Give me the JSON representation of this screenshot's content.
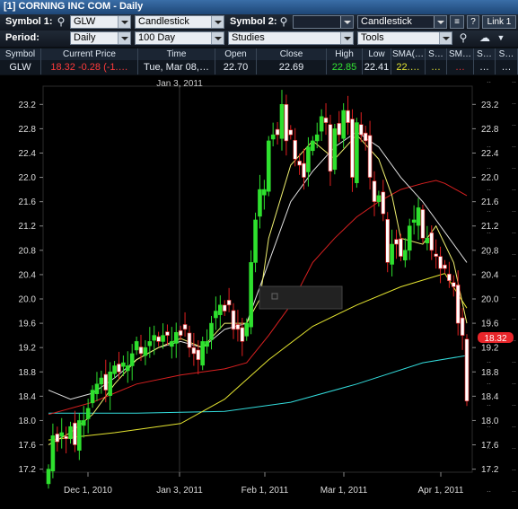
{
  "window": {
    "title": "[1] CORNING INC COM - Daily"
  },
  "toolbar": {
    "symbol1_label": "Symbol 1:",
    "symbol1_value": "GLW",
    "chart_type1": "Candlestick",
    "symbol2_label": "Symbol 2:",
    "symbol2_value": "",
    "chart_type2": "Candlestick",
    "help": "?",
    "link": "Link 1",
    "period_label": "Period:",
    "period": "Daily",
    "range": "100 Day",
    "studies": "Studies",
    "tools": "Tools"
  },
  "quote": {
    "headers": [
      "Symbol",
      "Current Price",
      "Time",
      "Open",
      "Close",
      "High",
      "Low",
      "SMA(…",
      "S…",
      "SM…",
      "S…",
      "S…"
    ],
    "symbol": "GLW",
    "price": "18.32",
    "change": "-0.28 (-1.…",
    "time": "Tue, Mar 08,…",
    "open": "22.70",
    "close": "22.69",
    "high": "22.85",
    "low": "22.41",
    "sma": "22.…",
    "s1": "…",
    "s2": "…",
    "s3": "…",
    "s4": "…",
    "colors": {
      "down": "#ff3b3b",
      "up": "#33e633",
      "sma": "#e6e633"
    }
  },
  "chart_data": {
    "type": "candlestick",
    "y_ticks": [
      17.2,
      17.6,
      18.0,
      18.4,
      18.8,
      19.2,
      19.6,
      20.0,
      20.4,
      20.8,
      21.2,
      21.6,
      22.0,
      22.4,
      22.8,
      23.2
    ],
    "ylim": [
      17.15,
      23.5
    ],
    "x_labels": [
      "Dec 1, 2010",
      "Jan 3, 2011",
      "Feb 1, 2011",
      "Mar 1, 2011",
      "Apr 1, 2011"
    ],
    "top_date_label": "Jan 3, 2011",
    "last_price_tag": "18.32",
    "up_color": "#2ee02e",
    "down_color": "#e02020",
    "closes": [
      17.2,
      17.75,
      17.65,
      17.8,
      17.7,
      17.9,
      17.6,
      18.0,
      18.0,
      18.2,
      18.5,
      18.6,
      18.7,
      18.5,
      18.8,
      18.9,
      18.8,
      18.95,
      18.9,
      19.1,
      19.3,
      19.1,
      19.2,
      19.3,
      19.4,
      19.3,
      19.4,
      19.4,
      19.3,
      19.45,
      19.4,
      19.5,
      19.2,
      19.1,
      19.0,
      19.3,
      19.3,
      19.6,
      19.8,
      19.9,
      19.8,
      19.9,
      19.5,
      19.5,
      19.3,
      19.6,
      20.6,
      21.3,
      21.8,
      21.8,
      22.6,
      22.7,
      22.7,
      23.2,
      22.6,
      22.7,
      22.3,
      22.2,
      22.0,
      22.5,
      22.6,
      22.7,
      23.0,
      22.9,
      22.1,
      22.8,
      22.7,
      23.1,
      22.9,
      22.0,
      22.9,
      22.7,
      22.6,
      22.0,
      21.6,
      21.7,
      21.4,
      20.6,
      20.9,
      20.9,
      20.7,
      20.8,
      21.2,
      21.3,
      21.5,
      21.0,
      21.0,
      20.8,
      20.7,
      20.5,
      20.5,
      20.3,
      20.2,
      19.6,
      19.4,
      18.32
    ],
    "series": [
      {
        "name": "SMA 100",
        "color": "#33dddd",
        "points": [
          [
            0,
            18.12
          ],
          [
            20,
            18.12
          ],
          [
            40,
            18.15
          ],
          [
            55,
            18.3
          ],
          [
            70,
            18.6
          ],
          [
            85,
            18.95
          ],
          [
            95,
            19.07
          ]
        ]
      },
      {
        "name": "SMA 50",
        "color": "#e4e430",
        "points": [
          [
            0,
            17.68
          ],
          [
            15,
            17.8
          ],
          [
            30,
            17.95
          ],
          [
            40,
            18.35
          ],
          [
            50,
            19.0
          ],
          [
            60,
            19.55
          ],
          [
            70,
            19.9
          ],
          [
            80,
            20.2
          ],
          [
            90,
            20.42
          ],
          [
            95,
            19.85
          ]
        ]
      },
      {
        "name": "SMA 20",
        "color": "#d82020",
        "points": [
          [
            0,
            18.1
          ],
          [
            10,
            18.3
          ],
          [
            20,
            18.6
          ],
          [
            30,
            18.75
          ],
          [
            40,
            18.85
          ],
          [
            45,
            18.95
          ],
          [
            50,
            19.4
          ],
          [
            55,
            19.9
          ],
          [
            60,
            20.6
          ],
          [
            65,
            21.0
          ],
          [
            70,
            21.35
          ],
          [
            75,
            21.6
          ],
          [
            80,
            21.8
          ],
          [
            85,
            21.9
          ],
          [
            88,
            21.95
          ],
          [
            90,
            21.9
          ],
          [
            95,
            21.7
          ]
        ]
      },
      {
        "name": "SMA 10",
        "color": "#e0e0e0",
        "points": [
          [
            0,
            18.5
          ],
          [
            5,
            18.35
          ],
          [
            10,
            18.45
          ],
          [
            15,
            18.7
          ],
          [
            20,
            19.0
          ],
          [
            25,
            19.2
          ],
          [
            30,
            19.3
          ],
          [
            35,
            19.2
          ],
          [
            40,
            19.5
          ],
          [
            45,
            19.6
          ],
          [
            50,
            20.6
          ],
          [
            55,
            21.6
          ],
          [
            60,
            22.1
          ],
          [
            65,
            22.5
          ],
          [
            70,
            22.75
          ],
          [
            75,
            22.5
          ],
          [
            80,
            22.0
          ],
          [
            85,
            21.6
          ],
          [
            88,
            21.3
          ],
          [
            91,
            21.0
          ],
          [
            95,
            20.6
          ]
        ]
      },
      {
        "name": "SMA 5",
        "color": "#f0f070",
        "points": [
          [
            0,
            17.6
          ],
          [
            5,
            17.8
          ],
          [
            10,
            18.1
          ],
          [
            15,
            18.6
          ],
          [
            20,
            19.0
          ],
          [
            25,
            19.2
          ],
          [
            30,
            19.35
          ],
          [
            35,
            19.2
          ],
          [
            40,
            19.6
          ],
          [
            45,
            19.6
          ],
          [
            48,
            20.0
          ],
          [
            50,
            21.0
          ],
          [
            55,
            22.2
          ],
          [
            60,
            22.6
          ],
          [
            65,
            22.3
          ],
          [
            70,
            22.7
          ],
          [
            75,
            22.3
          ],
          [
            78,
            21.7
          ],
          [
            80,
            21.0
          ],
          [
            85,
            20.9
          ],
          [
            88,
            21.2
          ],
          [
            90,
            20.9
          ],
          [
            92,
            20.6
          ],
          [
            95,
            19.6
          ]
        ]
      }
    ]
  }
}
